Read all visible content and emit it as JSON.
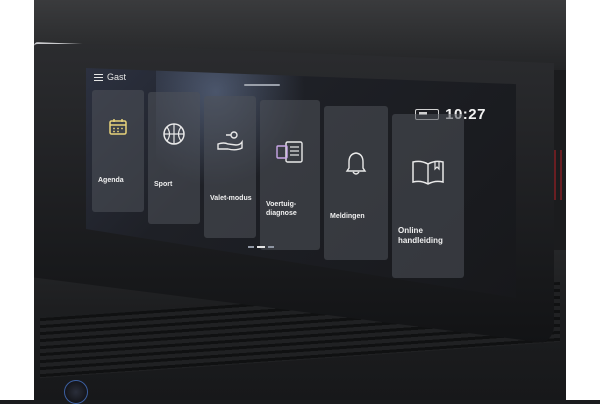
{
  "header": {
    "user_label": "Gast",
    "menu_icon": "hamburger-icon"
  },
  "status_bar": {
    "time": "10:27",
    "icon": "signal-icon"
  },
  "tiles": [
    {
      "label": "Agenda",
      "icon": "calendar-icon"
    },
    {
      "label": "Sport",
      "icon": "ball-icon"
    },
    {
      "label": "Valet-modus",
      "icon": "hand-key-icon"
    },
    {
      "label": "Voertuig-\ndiagnose",
      "icon": "clipboard-icon"
    },
    {
      "label": "Meldingen",
      "icon": "bell-icon"
    },
    {
      "label": "Online\nhandleiding",
      "icon": "book-icon"
    }
  ],
  "pager": {
    "pages": 3,
    "active": 2
  },
  "colors": {
    "icon_accent": "#e8d37a",
    "icon_stroke": "#e9e9e9",
    "tile_bg": "#4e525a"
  }
}
